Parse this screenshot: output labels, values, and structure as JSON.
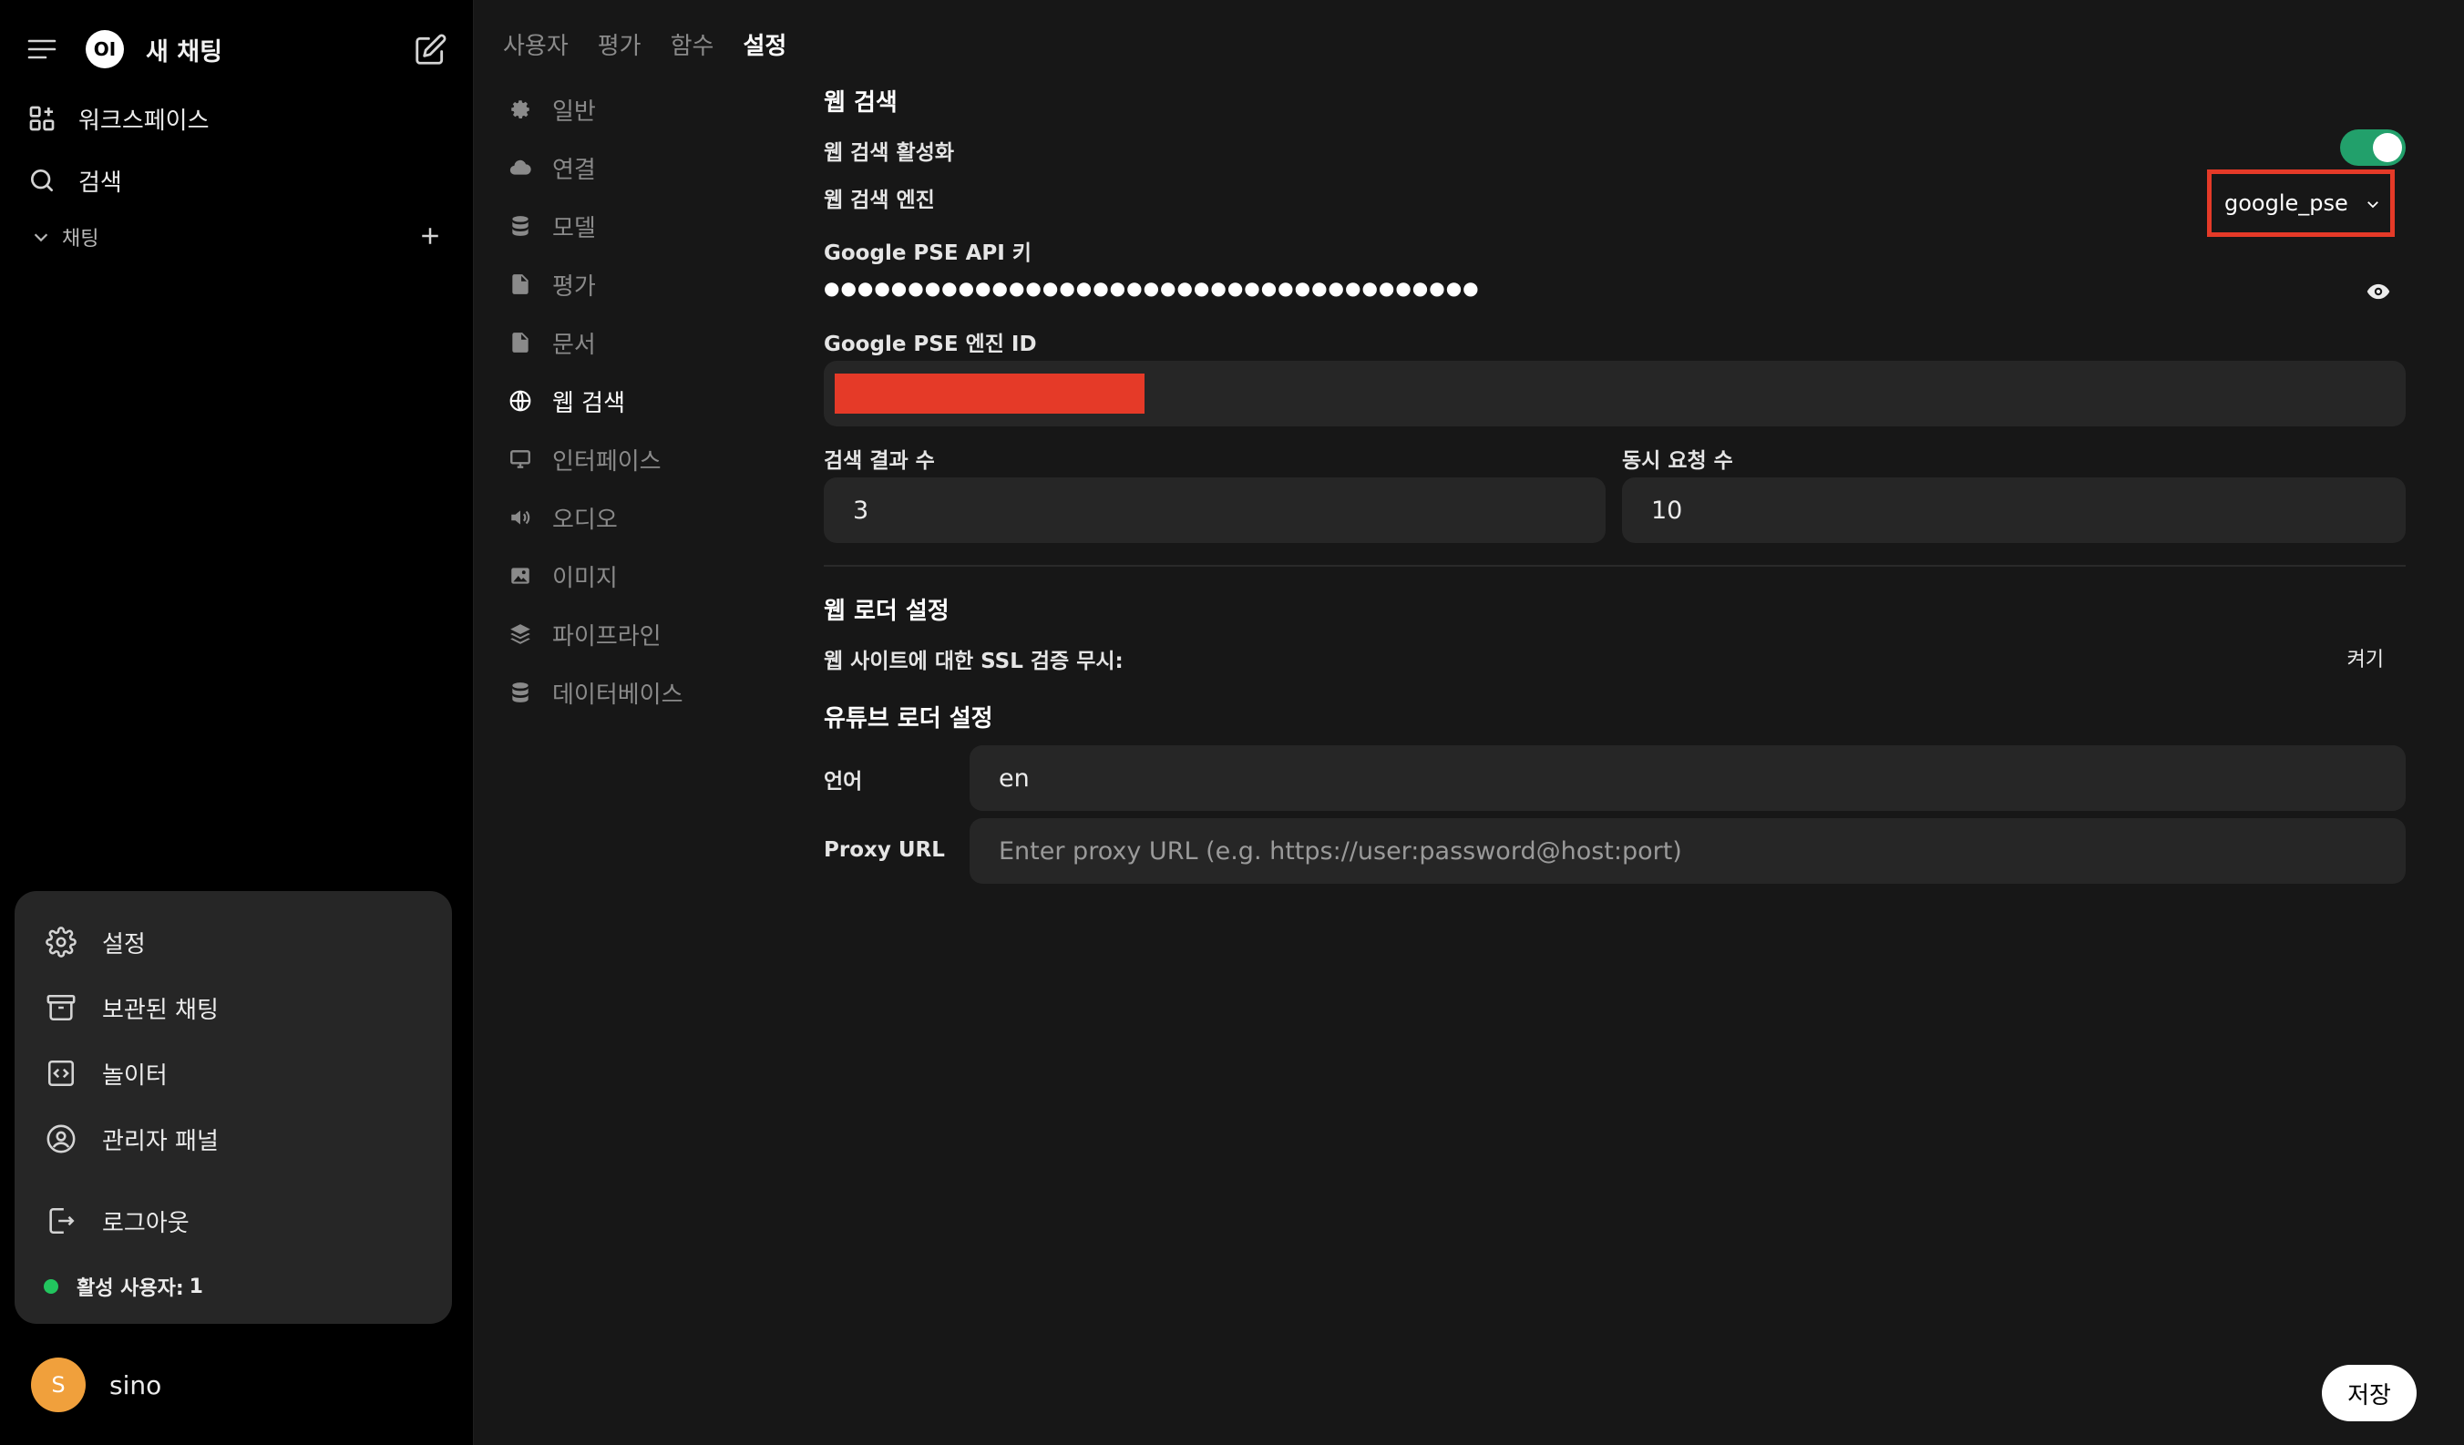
{
  "sidebar": {
    "logo_text": "OI",
    "new_chat": "새 채팅",
    "nav": [
      {
        "label": "워크스페이스",
        "icon": "workspace-icon"
      },
      {
        "label": "검색",
        "icon": "search-icon"
      }
    ],
    "section": {
      "label": "채팅"
    },
    "menu": [
      {
        "label": "설정",
        "icon": "gear-icon"
      },
      {
        "label": "보관된 채팅",
        "icon": "archive-icon"
      },
      {
        "label": "놀이터",
        "icon": "code-icon"
      },
      {
        "label": "관리자 패널",
        "icon": "user-circle-icon"
      },
      {
        "label": "로그아웃",
        "icon": "logout-icon"
      }
    ],
    "active_users_label": "활성 사용자:",
    "active_users_count": "1",
    "user": {
      "initial": "S",
      "name": "sino"
    }
  },
  "tabs": [
    {
      "label": "사용자",
      "active": false
    },
    {
      "label": "평가",
      "active": false
    },
    {
      "label": "함수",
      "active": false
    },
    {
      "label": "설정",
      "active": true
    }
  ],
  "settings_nav": [
    {
      "label": "일반",
      "icon": "gear-icon",
      "active": false
    },
    {
      "label": "연결",
      "icon": "cloud-icon",
      "active": false
    },
    {
      "label": "모델",
      "icon": "database-icon",
      "active": false
    },
    {
      "label": "평가",
      "icon": "document-icon",
      "active": false
    },
    {
      "label": "문서",
      "icon": "document-icon",
      "active": false
    },
    {
      "label": "웹 검색",
      "icon": "globe-icon",
      "active": true
    },
    {
      "label": "인터페이스",
      "icon": "monitor-icon",
      "active": false
    },
    {
      "label": "오디오",
      "icon": "speaker-icon",
      "active": false
    },
    {
      "label": "이미지",
      "icon": "image-icon",
      "active": false
    },
    {
      "label": "파이프라인",
      "icon": "layers-icon",
      "active": false
    },
    {
      "label": "데이터베이스",
      "icon": "database-icon",
      "active": false
    }
  ],
  "web_search": {
    "title": "웹 검색",
    "enable_label": "웹 검색 활성화",
    "enabled": true,
    "engine_label": "웹 검색 엔진",
    "engine_value": "google_pse",
    "api_key_label": "Google PSE API 키",
    "api_key_masked": "●●●●●●●●●●●●●●●●●●●●●●●●●●●●●●●●●●●●●●●",
    "engine_id_label": "Google PSE 엔진 ID",
    "result_count_label": "검색 결과 수",
    "result_count_value": "3",
    "concurrent_label": "동시 요청 수",
    "concurrent_value": "10"
  },
  "web_loader": {
    "title": "웹 로더 설정",
    "ssl_label": "웹 사이트에 대한 SSL 검증 무시:",
    "ssl_state": "켜기"
  },
  "youtube_loader": {
    "title": "유튜브 로더 설정",
    "language_label": "언어",
    "language_value": "en",
    "proxy_label": "Proxy URL",
    "proxy_placeholder": "Enter proxy URL (e.g. https://user:password@host:port)"
  },
  "save_label": "저장",
  "colors": {
    "accent_toggle": "#22a06b",
    "highlight_box": "#e53a28",
    "status_dot": "#22c55e",
    "avatar": "#f0a03c"
  }
}
